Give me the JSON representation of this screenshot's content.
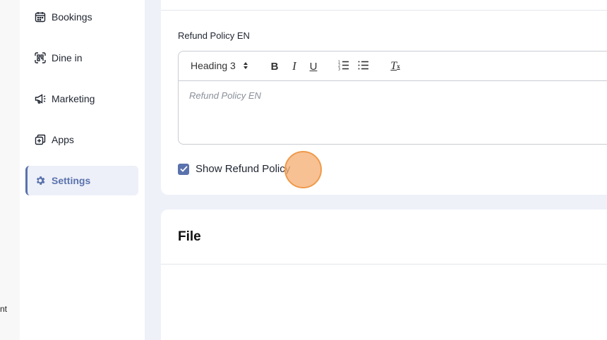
{
  "left_strip": {
    "text": "nt"
  },
  "sidebar": {
    "items": [
      {
        "label": "Bookings",
        "icon": "calendar-icon"
      },
      {
        "label": "Dine in",
        "icon": "qr-scan-icon"
      },
      {
        "label": "Marketing",
        "icon": "megaphone-icon"
      },
      {
        "label": "Apps",
        "icon": "apps-icon"
      },
      {
        "label": "Settings",
        "icon": "gear-icon",
        "active": true
      }
    ]
  },
  "refund_policy": {
    "label": "Refund Policy EN",
    "toolbar": {
      "heading_select": "Heading 3",
      "bold": "B",
      "italic": "I",
      "underline": "U",
      "clear_format": "T"
    },
    "placeholder": "Refund Policy EN"
  },
  "show_refund_policy": {
    "label": "Show Refund Policy",
    "checked": true
  },
  "file_section": {
    "title": "File"
  },
  "colors": {
    "accent": "#5a72ad",
    "click_marker": "#f6b076",
    "page_background": "#eef1f8"
  }
}
